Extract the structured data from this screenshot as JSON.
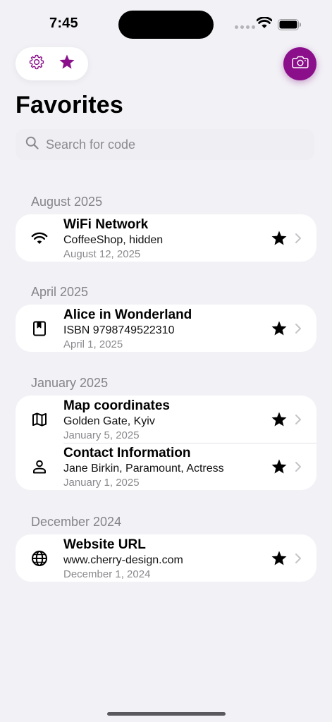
{
  "status": {
    "time": "7:45"
  },
  "header": {
    "title": "Favorites"
  },
  "search": {
    "placeholder": "Search for code"
  },
  "sections": [
    {
      "title": "August 2025",
      "items": [
        {
          "icon": "wifi-icon",
          "title": "WiFi Network",
          "subtitle": "CoffeeShop, hidden",
          "date": "August 12, 2025"
        }
      ]
    },
    {
      "title": "April 2025",
      "items": [
        {
          "icon": "book-icon",
          "title": "Alice in Wonderland",
          "subtitle": "ISBN 9798749522310",
          "date": "April 1, 2025"
        }
      ]
    },
    {
      "title": "January 2025",
      "items": [
        {
          "icon": "map-icon",
          "title": "Map coordinates",
          "subtitle": "Golden Gate, Kyiv",
          "date": "January 5, 2025"
        },
        {
          "icon": "person-icon",
          "title": "Contact Information",
          "subtitle": "Jane Birkin, Paramount, Actress",
          "date": "January 1, 2025"
        }
      ]
    },
    {
      "title": "December 2024",
      "items": [
        {
          "icon": "globe-icon",
          "title": "Website URL",
          "subtitle": "www.cherry-design.com",
          "date": "December 1, 2024"
        }
      ]
    }
  ],
  "colors": {
    "accent": "#8b0f8b",
    "background": "#f2f1f6"
  }
}
